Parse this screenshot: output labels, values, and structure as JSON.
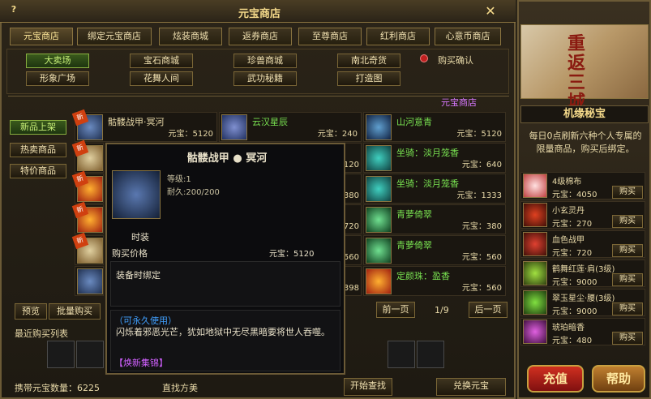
{
  "window": {
    "title": "元宝商店",
    "help": "?",
    "close": "✕"
  },
  "tabs": [
    "元宝商店",
    "绑定元宝商店",
    "炫装商城",
    "返券商店",
    "至尊商店",
    "红利商店",
    "心意币商店"
  ],
  "categories": {
    "row1": [
      "大卖场",
      "宝石商城",
      "珍兽商城",
      "南北奇货"
    ],
    "row2": [
      "形象广场",
      "花舞人间",
      "武功秘籍",
      "打造图"
    ],
    "buy_confirm": "购买确认"
  },
  "breadcrumb": "元宝商店",
  "side_categories": [
    "新品上架",
    "热卖商品",
    "特价商品"
  ],
  "price_prefix": "元宝：",
  "new_tag": "新",
  "items": [
    {
      "name": "骷髅战甲·冥河",
      "price": "5120"
    },
    {
      "name": "云汉星辰",
      "price": "240"
    },
    {
      "name": "山河意青",
      "price": "5120"
    },
    {
      "name": "",
      "price": "120"
    },
    {
      "name": "坐骑：淡月笼香",
      "price": "640"
    },
    {
      "name": "",
      "price": "380"
    },
    {
      "name": "坐骑：淡月笼香",
      "price": "1333"
    },
    {
      "name": "",
      "price": "720"
    },
    {
      "name": "青萝倚翠",
      "price": "380"
    },
    {
      "name": "",
      "price": "560"
    },
    {
      "name": "青萝倚翠",
      "price": "560"
    },
    {
      "name": "",
      "price": "398"
    },
    {
      "name": "定颜珠：盈香",
      "price": "560"
    }
  ],
  "tooltip": {
    "title": "骷髅战甲 ● 冥河",
    "level": "等级:1",
    "durability": "耐久:200/200",
    "type": "时装",
    "price_label": "购买价格",
    "price": "元宝：5120",
    "bind": "装备时绑定",
    "permanent": "（可永久使用）",
    "desc": "闪烁着邪恶光芒，犹如地狱中无尽黑暗要将世人吞噬。",
    "collection": "【焕新集锦】"
  },
  "bottom": {
    "preview": "预览",
    "batch_buy": "批量购买",
    "recent_label": "最近购买列表",
    "prev_page": "前一页",
    "page": "1/9",
    "next_page": "后一页",
    "carried_label": "携带元宝数量：6225",
    "search_label": "直找方美",
    "search_btn": "开始查找",
    "exchange_btn": "兑换元宝"
  },
  "right": {
    "banner_text": "重返三城",
    "title": "机缘秘宝",
    "desc": "每日0点刷新六种个人专属的限量商品，购买后绑定。",
    "buy_label": "购买",
    "items": [
      {
        "name": "4级棉布",
        "price": "元宝：4050"
      },
      {
        "name": "小玄灵丹",
        "price": "元宝：270"
      },
      {
        "name": "血色战甲",
        "price": "元宝：720"
      },
      {
        "name": "鹤舞红莲·肩(3级)",
        "price": "元宝：9000"
      },
      {
        "name": "翠玉星尘·腰(3级)",
        "price": "元宝：9000"
      },
      {
        "name": "琥珀暗香",
        "price": "元宝：480"
      }
    ],
    "recharge": "充值",
    "help": "帮助"
  }
}
